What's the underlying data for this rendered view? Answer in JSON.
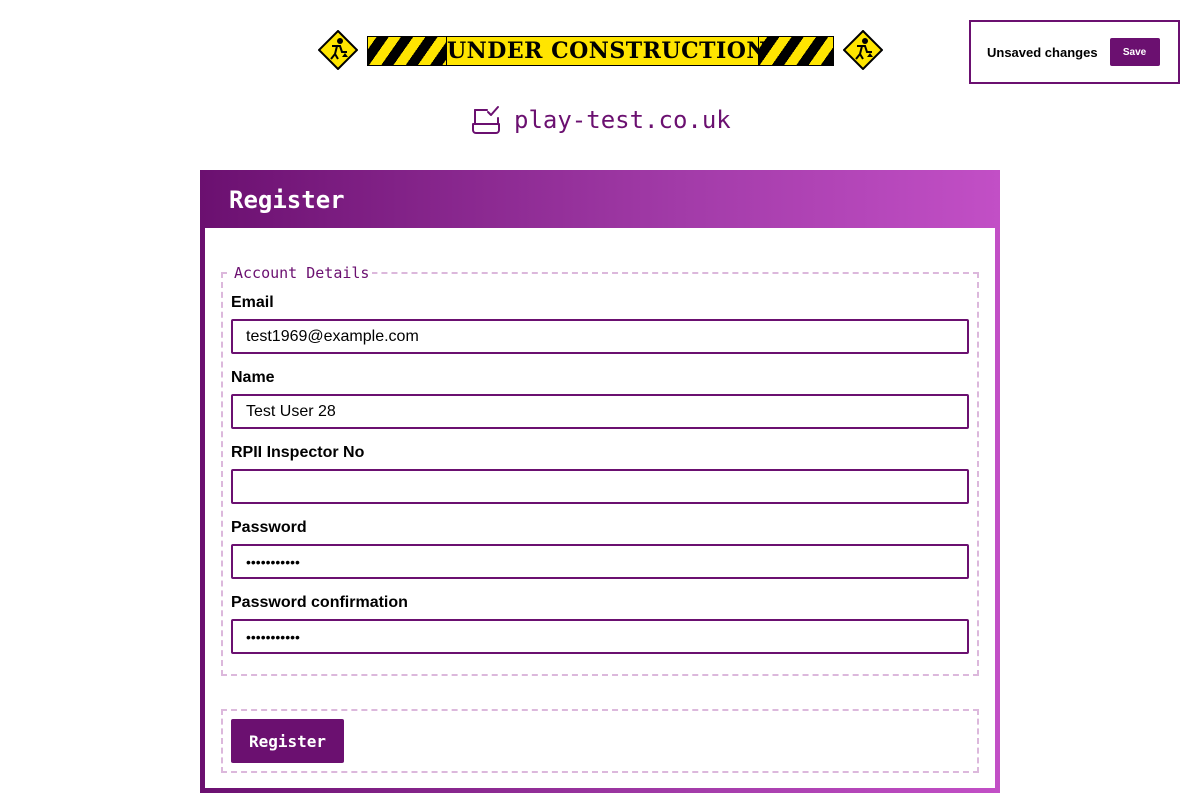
{
  "banner": {
    "text": "UNDER CONSTRUCTION"
  },
  "toast": {
    "message": "Unsaved changes",
    "save_label": "Save"
  },
  "site": {
    "name": "play-test.co.uk"
  },
  "form": {
    "title": "Register",
    "fieldset_legend": "Account Details",
    "fields": [
      {
        "label": "Email",
        "value": "test1969@example.com",
        "type": "email"
      },
      {
        "label": "Name",
        "value": "Test User 28",
        "type": "text"
      },
      {
        "label": "RPII Inspector No",
        "value": "",
        "type": "text"
      },
      {
        "label": "Password",
        "value": "•••••••••••",
        "type": "password"
      },
      {
        "label": "Password confirmation",
        "value": "•••••••••••",
        "type": "password"
      }
    ],
    "submit_label": "Register"
  },
  "colors": {
    "brand": "#6b1070",
    "brand_light": "#c24fc6",
    "dashed_border": "#dcb8dc",
    "warning_yellow": "#ffe500"
  },
  "icons": {
    "construction_sign": "worker-sign-icon",
    "site_logo": "checkbox-tray-icon"
  }
}
